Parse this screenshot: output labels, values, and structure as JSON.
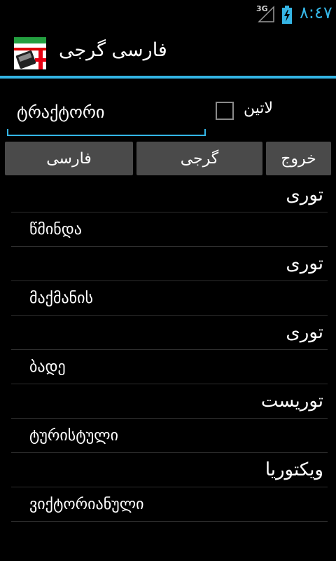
{
  "status_bar": {
    "network": "3G",
    "time": "٨:٤٧",
    "accent": "#35b5e5"
  },
  "action_bar": {
    "title": "فارسی گرجی",
    "icon": "georgia-iran-flag-icon"
  },
  "input": {
    "value": "ტრაქტორი",
    "placeholder": ""
  },
  "checkbox": {
    "label": "لاتین",
    "checked": false
  },
  "buttons": {
    "farsi": "فارسی",
    "gorji": "گرجی",
    "exit": "خروج"
  },
  "results": [
    {
      "fa": "توری",
      "ka": "წმინდა"
    },
    {
      "fa": "توری",
      "ka": "მაქმანის"
    },
    {
      "fa": "توری",
      "ka": "ბადე"
    },
    {
      "fa": "توریست",
      "ka": "ტურისტული"
    },
    {
      "fa": "ویکتوریا",
      "ka": "ვიქტორიანული"
    }
  ]
}
